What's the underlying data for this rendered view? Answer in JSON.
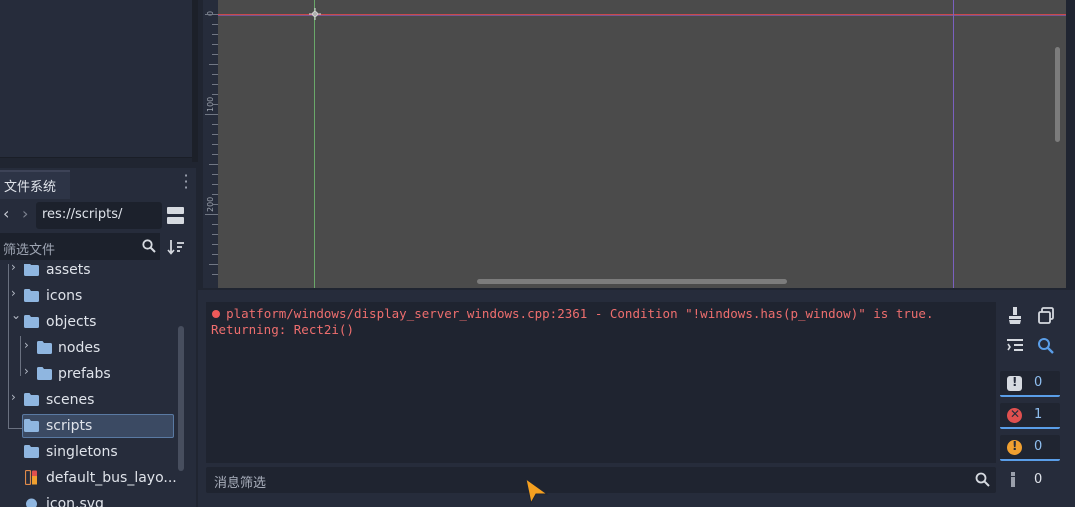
{
  "filesystem": {
    "tab_label": "文件系统",
    "path": "res://scripts/",
    "filter_placeholder": "筛选文件",
    "tree": [
      {
        "label": "assets",
        "type": "folder",
        "arrow": "›"
      },
      {
        "label": "icons",
        "type": "folder",
        "arrow": "›"
      },
      {
        "label": "objects",
        "type": "folder",
        "arrow": "⌄"
      },
      {
        "label": "nodes",
        "type": "folder",
        "arrow": "›"
      },
      {
        "label": "prefabs",
        "type": "folder",
        "arrow": "›"
      },
      {
        "label": "scenes",
        "type": "folder",
        "arrow": "›"
      },
      {
        "label": "scripts",
        "type": "folder",
        "arrow": ""
      },
      {
        "label": "singletons",
        "type": "folder",
        "arrow": ""
      },
      {
        "label": "default_bus_layo...",
        "type": "audio-bus-file",
        "arrow": ""
      },
      {
        "label": "icon.svg",
        "type": "svg-file",
        "arrow": ""
      }
    ],
    "selected": "scripts"
  },
  "viewport": {
    "ruler_labels": [
      "0",
      "100",
      "200"
    ]
  },
  "output": {
    "log_line1": "platform/windows/display_server_windows.cpp:2361 - Condition \"!windows.has(p_window)\" is true.",
    "log_line2": "Returning: Rect2i()",
    "filter_placeholder": "消息筛选",
    "counts": {
      "messages": "0",
      "errors": "1",
      "warnings": "0",
      "editor": "0"
    }
  },
  "colors": {
    "error": "#e0504f",
    "warning": "#f0a030",
    "accent": "#5a9ee8",
    "folder": "#8fb6e0"
  }
}
